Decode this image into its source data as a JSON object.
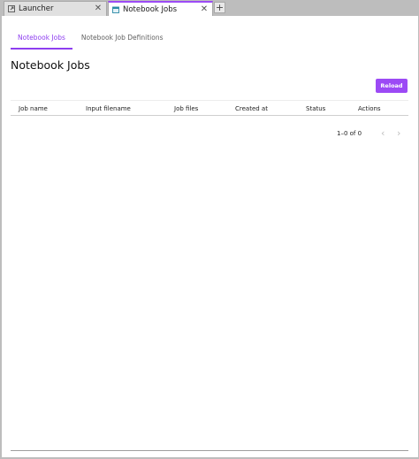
{
  "tabs": [
    {
      "label": "Launcher",
      "icon": "launcher-icon",
      "active": false
    },
    {
      "label": "Notebook Jobs",
      "icon": "calendar-icon",
      "active": true
    }
  ],
  "add_tab_label": "+",
  "close_glyph": "✕",
  "subtabs": [
    {
      "label": "Notebook Jobs",
      "active": true
    },
    {
      "label": "Notebook Job Definitions",
      "active": false
    }
  ],
  "page": {
    "title": "Notebook Jobs",
    "reload_label": "Reload"
  },
  "table": {
    "columns": [
      "Job name",
      "Input filename",
      "Job files",
      "Created at",
      "Status",
      "Actions"
    ],
    "rows": []
  },
  "pagination": {
    "range": "1–0 of 0",
    "prev_glyph": "‹",
    "next_glyph": "›"
  },
  "colors": {
    "accent": "#9c4af5",
    "tab_bar": "#bdbdbd"
  }
}
